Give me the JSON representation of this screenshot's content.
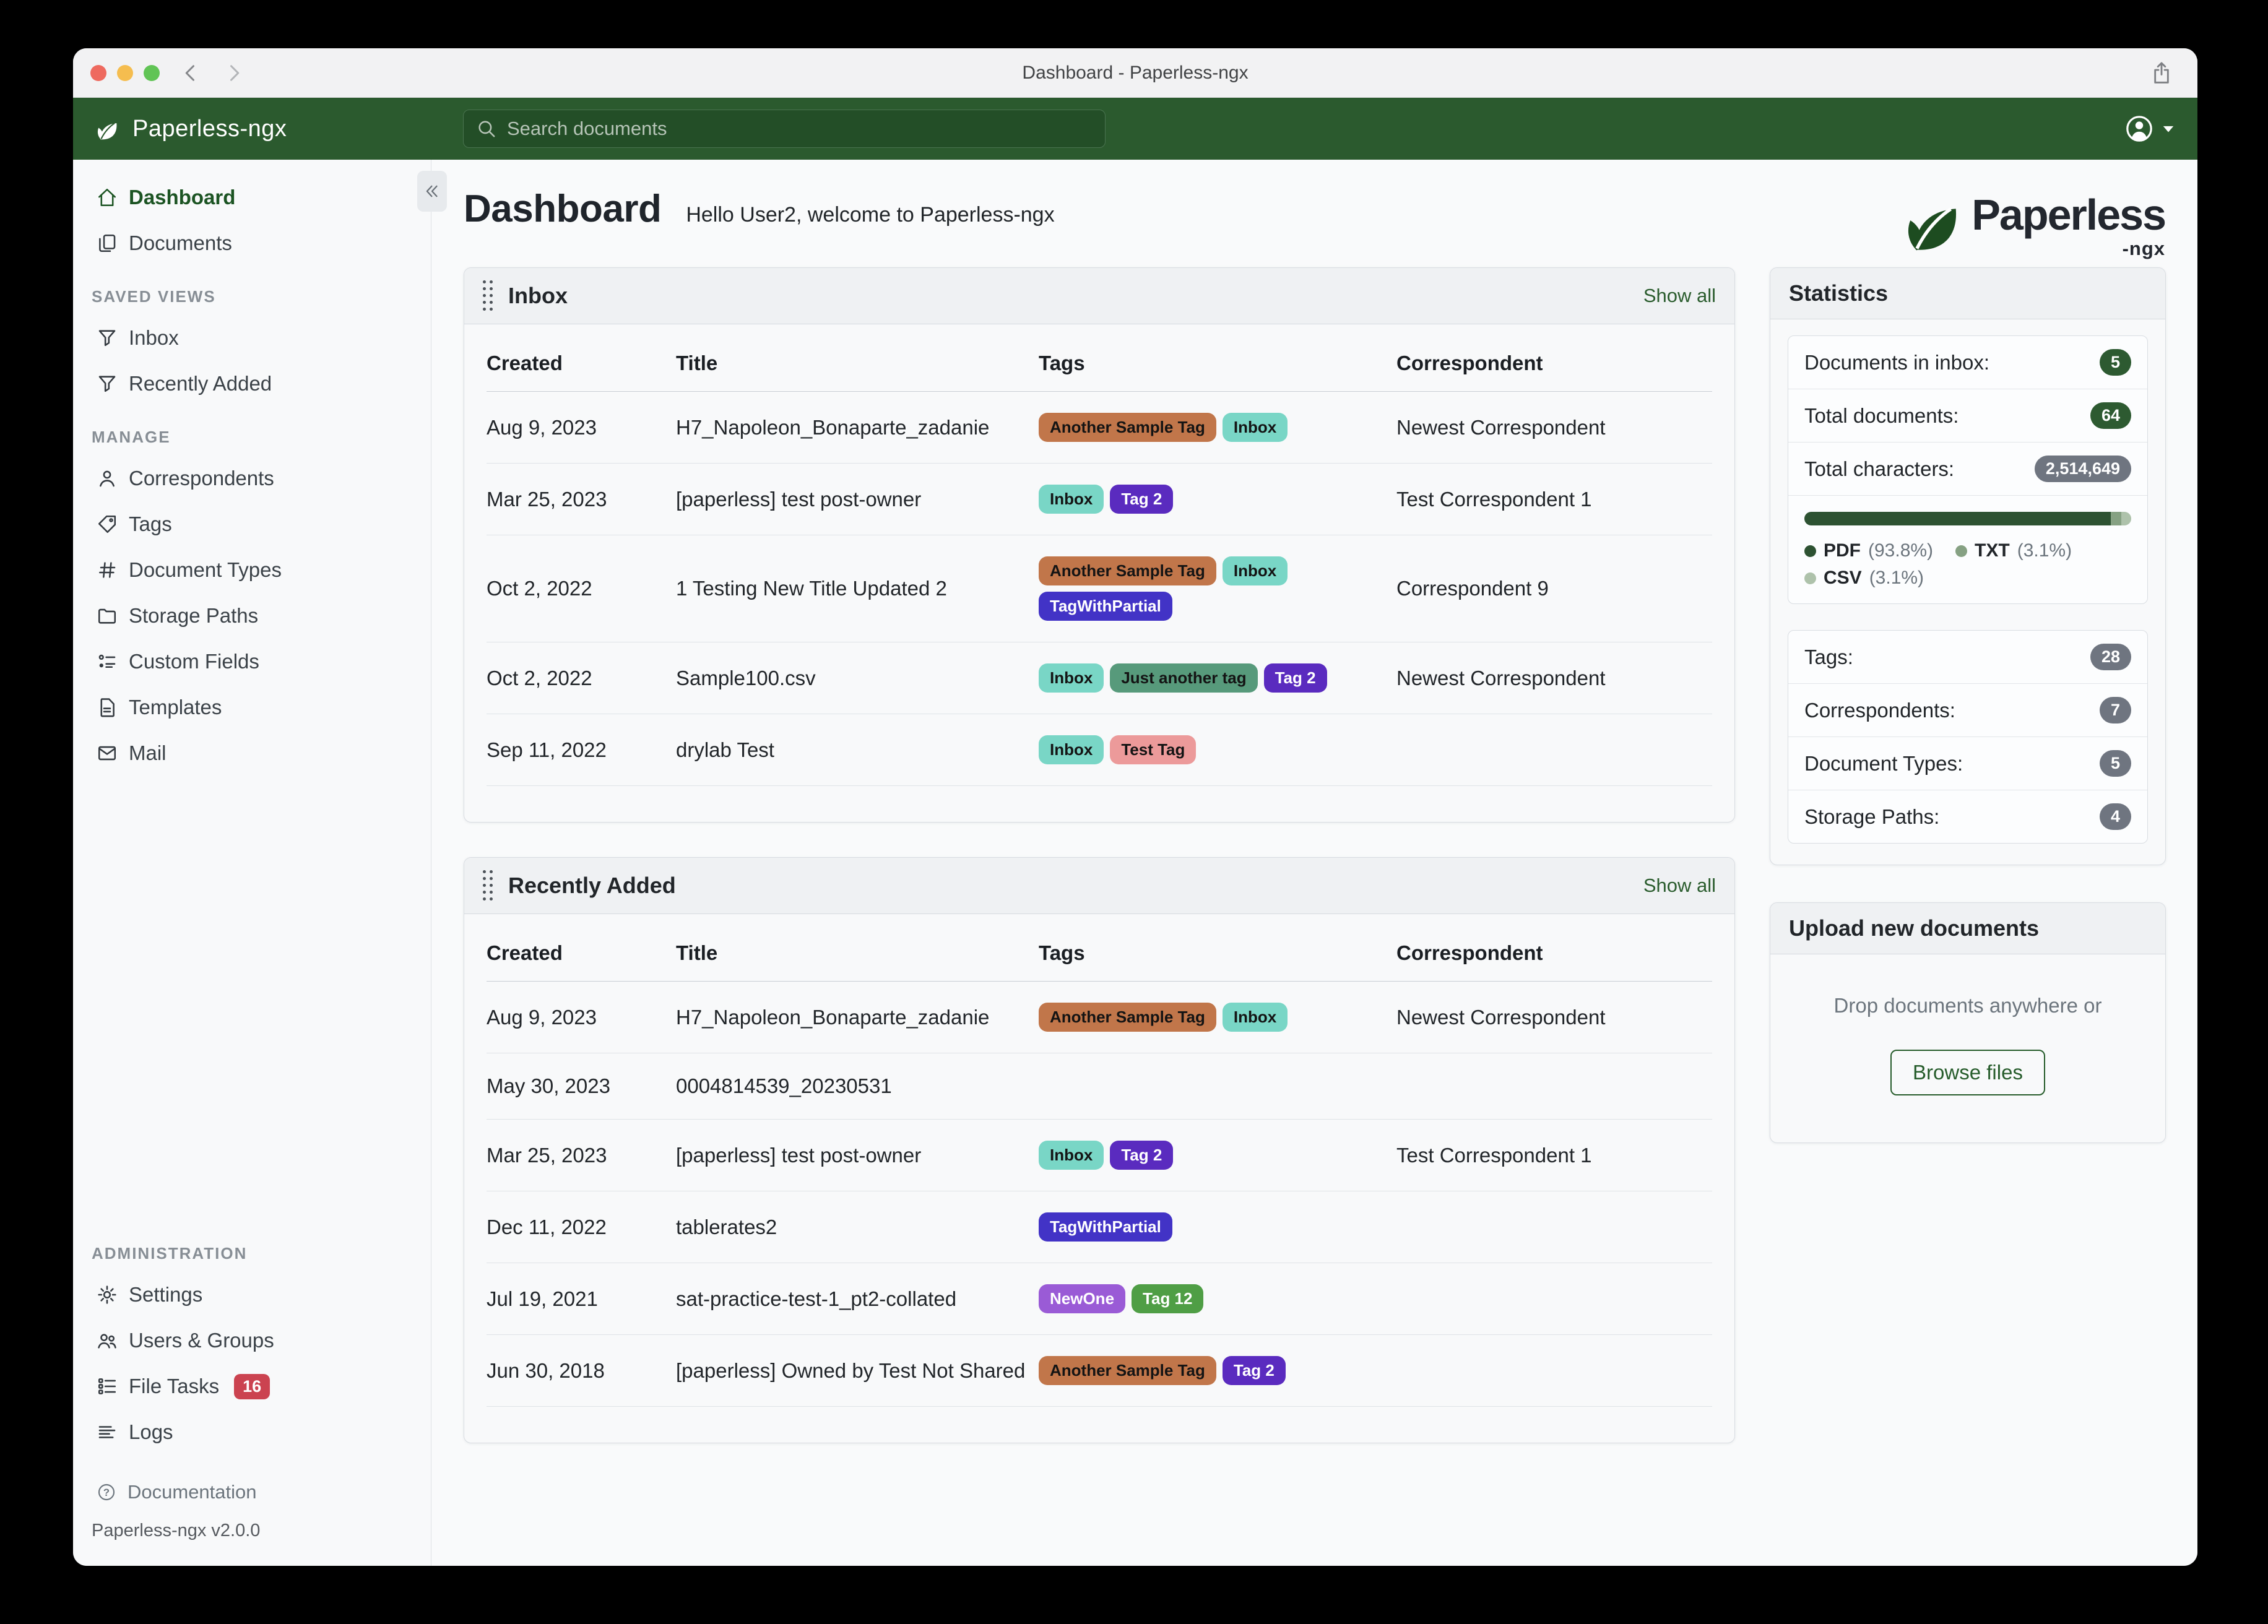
{
  "titlebar": {
    "title": "Dashboard - Paperless-ngx"
  },
  "navbar": {
    "brand": "Paperless-ngx",
    "search_placeholder": "Search documents"
  },
  "logo": {
    "word": "Paperless",
    "sub": "-ngx"
  },
  "page": {
    "title": "Dashboard",
    "subtitle": "Hello User2, welcome to Paperless-ngx"
  },
  "sidebar": {
    "groups": [
      {
        "heading": "",
        "items": [
          {
            "label": "Dashboard",
            "icon": "house",
            "active": true
          },
          {
            "label": "Documents",
            "icon": "copy"
          }
        ]
      },
      {
        "heading": "SAVED VIEWS",
        "items": [
          {
            "label": "Inbox",
            "icon": "funnel"
          },
          {
            "label": "Recently Added",
            "icon": "funnel"
          }
        ]
      },
      {
        "heading": "MANAGE",
        "items": [
          {
            "label": "Correspondents",
            "icon": "person"
          },
          {
            "label": "Tags",
            "icon": "tag"
          },
          {
            "label": "Document Types",
            "icon": "hash"
          },
          {
            "label": "Storage Paths",
            "icon": "folder"
          },
          {
            "label": "Custom Fields",
            "icon": "fields"
          },
          {
            "label": "Templates",
            "icon": "template"
          },
          {
            "label": "Mail",
            "icon": "envelope"
          }
        ]
      }
    ],
    "admin_group": {
      "heading": "ADMINISTRATION",
      "items": [
        {
          "label": "Settings",
          "icon": "gear"
        },
        {
          "label": "Users & Groups",
          "icon": "people"
        },
        {
          "label": "File Tasks",
          "icon": "tasks",
          "badge": "16"
        },
        {
          "label": "Logs",
          "icon": "logs"
        }
      ]
    },
    "footer": {
      "documentation": "Documentation",
      "version": "Paperless-ngx v2.0.0"
    }
  },
  "tags": {
    "another_sample_tag": {
      "label": "Another Sample Tag",
      "bg": "#c1764a",
      "fg": "#141414"
    },
    "inbox": {
      "label": "Inbox",
      "bg": "#79d6c6",
      "fg": "#141414"
    },
    "tag2": {
      "label": "Tag 2",
      "bg": "#5a2bbf",
      "fg": "#ffffff"
    },
    "tag_with_partial": {
      "label": "TagWithPartial",
      "bg": "#4233c6",
      "fg": "#ffffff"
    },
    "just_another_tag": {
      "label": "Just another tag",
      "bg": "#579a7b",
      "fg": "#141414"
    },
    "test_tag": {
      "label": "Test Tag",
      "bg": "#ec9a9a",
      "fg": "#141414"
    },
    "new_one": {
      "label": "NewOne",
      "bg": "#9a5bd6",
      "fg": "#ffffff"
    },
    "tag12": {
      "label": "Tag 12",
      "bg": "#4f9e45",
      "fg": "#ffffff"
    }
  },
  "inbox_section": {
    "title": "Inbox",
    "show_all": "Show all",
    "columns": [
      "Created",
      "Title",
      "Tags",
      "Correspondent"
    ],
    "rows": [
      {
        "created": "Aug 9, 2023",
        "title": "H7_Napoleon_Bonaparte_zadanie",
        "tags": [
          "another_sample_tag",
          "inbox"
        ],
        "correspondent": "Newest Correspondent"
      },
      {
        "created": "Mar 25, 2023",
        "title": "[paperless] test post-owner",
        "tags": [
          "inbox",
          "tag2"
        ],
        "correspondent": "Test Correspondent 1"
      },
      {
        "created": "Oct 2, 2022",
        "title": "1 Testing New Title Updated 2",
        "tags": [
          "another_sample_tag",
          "inbox",
          "tag_with_partial"
        ],
        "correspondent": "Correspondent 9"
      },
      {
        "created": "Oct 2, 2022",
        "title": "Sample100.csv",
        "tags": [
          "inbox",
          "just_another_tag",
          "tag2"
        ],
        "correspondent": "Newest Correspondent"
      },
      {
        "created": "Sep 11, 2022",
        "title": "drylab Test",
        "tags": [
          "inbox",
          "test_tag"
        ],
        "correspondent": ""
      }
    ]
  },
  "recent_section": {
    "title": "Recently Added",
    "show_all": "Show all",
    "columns": [
      "Created",
      "Title",
      "Tags",
      "Correspondent"
    ],
    "rows": [
      {
        "created": "Aug 9, 2023",
        "title": "H7_Napoleon_Bonaparte_zadanie",
        "tags": [
          "another_sample_tag",
          "inbox"
        ],
        "correspondent": "Newest Correspondent"
      },
      {
        "created": "May 30, 2023",
        "title": "0004814539_20230531",
        "tags": [],
        "correspondent": ""
      },
      {
        "created": "Mar 25, 2023",
        "title": "[paperless] test post-owner",
        "tags": [
          "inbox",
          "tag2"
        ],
        "correspondent": "Test Correspondent 1"
      },
      {
        "created": "Dec 11, 2022",
        "title": "tablerates2",
        "tags": [
          "tag_with_partial"
        ],
        "correspondent": ""
      },
      {
        "created": "Jul 19, 2021",
        "title": "sat-practice-test-1_pt2-collated",
        "tags": [
          "new_one",
          "tag12"
        ],
        "correspondent": ""
      },
      {
        "created": "Jun 30, 2018",
        "title": "[paperless] Owned by Test Not Shared",
        "tags": [
          "another_sample_tag",
          "tag2"
        ],
        "correspondent": ""
      }
    ]
  },
  "statistics": {
    "title": "Statistics",
    "group1": [
      {
        "label": "Documents in inbox:",
        "value": "5",
        "style": "green"
      },
      {
        "label": "Total documents:",
        "value": "64",
        "style": "green"
      },
      {
        "label": "Total characters:",
        "value": "2,514,649",
        "style": "gray"
      }
    ],
    "chart_data": {
      "type": "stacked-bar",
      "series": [
        {
          "name": "PDF",
          "pct_label": "(93.8%)",
          "value": 93.8,
          "color": "#2d5232"
        },
        {
          "name": "TXT",
          "pct_label": "(3.1%)",
          "value": 3.1,
          "color": "#86a183"
        },
        {
          "name": "CSV",
          "pct_label": "(3.1%)",
          "value": 3.1,
          "color": "#aec2ab"
        }
      ]
    },
    "group2": [
      {
        "label": "Tags:",
        "value": "28",
        "style": "gray"
      },
      {
        "label": "Correspondents:",
        "value": "7",
        "style": "gray"
      },
      {
        "label": "Document Types:",
        "value": "5",
        "style": "gray"
      },
      {
        "label": "Storage Paths:",
        "value": "4",
        "style": "gray"
      }
    ]
  },
  "upload": {
    "title": "Upload new documents",
    "hint": "Drop documents anywhere or",
    "button": "Browse files"
  }
}
